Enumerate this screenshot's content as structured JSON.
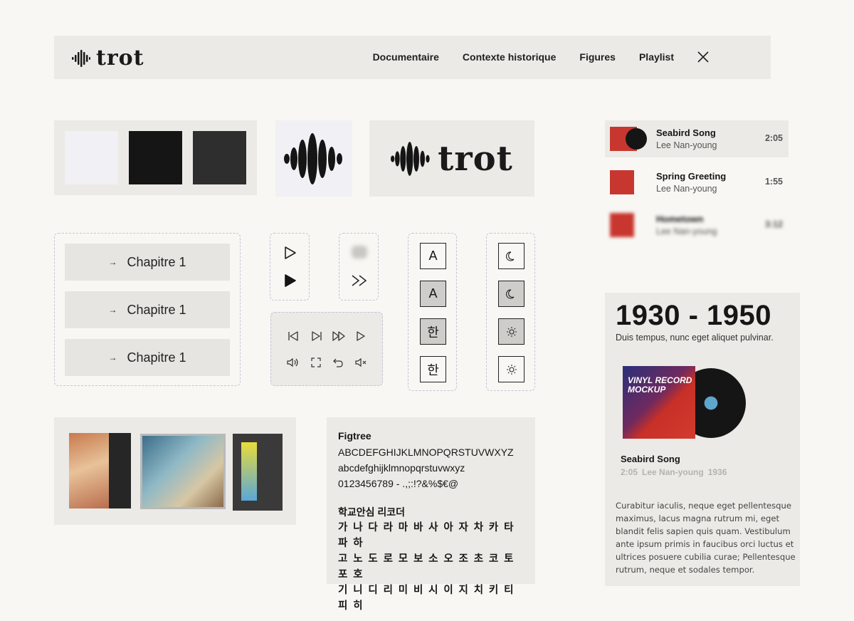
{
  "nav": {
    "logo_text": "trot",
    "items": [
      "Documentaire",
      "Contexte historique",
      "Figures",
      "Playlist"
    ]
  },
  "colors": {
    "swatches": [
      "#f1f0f5",
      "#151515",
      "#2e2e2e"
    ],
    "panel": "#ebeae6",
    "background": "#f8f7f3",
    "accent_red": "#c8372f"
  },
  "brand": {
    "logo_text": "trot"
  },
  "chapters": [
    "Chapitre 1",
    "Chapitre 1",
    "Chapitre 1"
  ],
  "icons": {
    "playback": [
      "play-outline-icon",
      "play-filled-icon",
      "loading-icon",
      "fast-forward-icon"
    ],
    "controls": [
      "skip-back-icon",
      "skip-forward-icon",
      "fast-forward-icon",
      "play-icon",
      "volume-icon",
      "fullscreen-icon",
      "undo-icon",
      "mute-icon"
    ],
    "theme": [
      "moon-icon",
      "moon-icon",
      "sun-icon",
      "sun-icon"
    ]
  },
  "text_size": [
    "A",
    "A",
    "한",
    "한"
  ],
  "typography": {
    "font_name": "Figtree",
    "upper": "ABCDEFGHIJKLMNOPQRSTUVWXYZ",
    "lower": "abcdefghijklmnopqrstuvwxyz",
    "digits": "0123456789 - .,;:!?&%$€@",
    "korean_title": "학교안심 리코더",
    "korean_lines": [
      "가 나 다 라 마 바 사 아 자 차 카 타 파 하",
      "고 노 도 로 모 보 소 오 조 초 코 토 포 호",
      "기 니 디 리 미 비 시 이 지 치 키 티 피 히"
    ]
  },
  "playlist": [
    {
      "title": "Seabird Song",
      "artist": "Lee Nan-young",
      "time": "2:05"
    },
    {
      "title": "Spring Greeting",
      "artist": "Lee Nan-young",
      "time": "1:55"
    },
    {
      "title": "Hometown",
      "artist": "Lee Nan-young",
      "time": "3:12"
    }
  ],
  "era": {
    "years": "1930 - 1950",
    "subtitle": "Duis tempus, nunc eget aliquet pulvinar.",
    "cover_text": "VINYL RECORD MOCKUP",
    "song": "Seabird Song",
    "duration": "2:05",
    "artist": "Lee Nan-young",
    "year": "1936",
    "description": "Curabitur iaculis, neque eget pellentesque maximus, lacus magna rutrum mi, eget blandit felis sapien quis quam. Vestibulum ante ipsum primis in faucibus orci luctus et ultrices posuere cubilia curae; Pellentesque rutrum, neque et sodales tempor."
  }
}
